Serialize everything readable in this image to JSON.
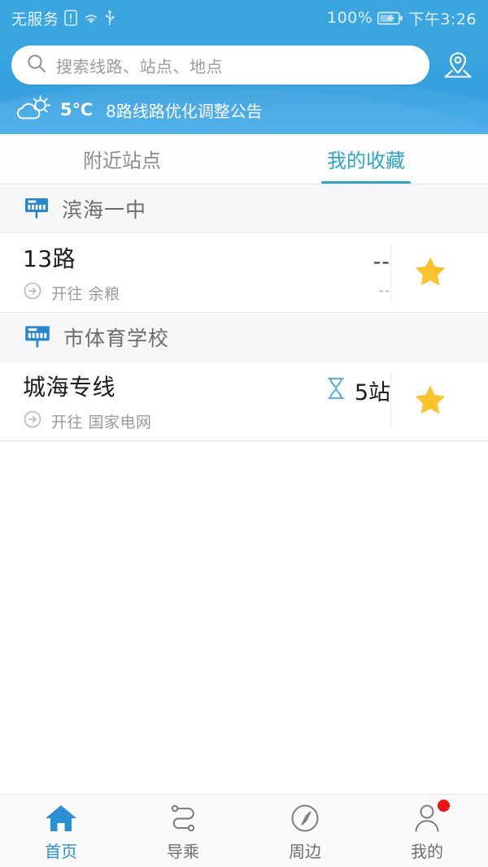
{
  "statusbar": {
    "carrier": "无服务",
    "battery_percent": "100%",
    "time": "下午3:26",
    "icons": [
      "sim-warning-icon",
      "wifi-icon",
      "usb-icon",
      "battery-charging-icon"
    ]
  },
  "header": {
    "search": {
      "placeholder": "搜索线路、站点、地点",
      "icon": "search-icon"
    },
    "map_button_icon": "map-location-pin-icon",
    "weather": {
      "icon": "sun-behind-cloud-icon",
      "temperature": "5℃"
    },
    "notice": "8路线路优化调整公告"
  },
  "tabs": [
    {
      "label": "附近站点",
      "active": false
    },
    {
      "label": "我的收藏",
      "active": true
    }
  ],
  "stations": [
    {
      "name": "滨海一中",
      "icon": "bus-stop-sign-icon",
      "routes": [
        {
          "name": "13路",
          "direction_icon": "arrow-right-circle-icon",
          "direction": "开往 余粮",
          "status_icon": null,
          "status_main": "--",
          "status_sub": "--",
          "favorite_icon": "star-filled-icon",
          "favorited": true
        }
      ]
    },
    {
      "name": "市体育学校",
      "icon": "bus-stop-sign-icon",
      "routes": [
        {
          "name": "城海专线",
          "direction_icon": "arrow-right-circle-icon",
          "direction": "开往 国家电网",
          "status_icon": "hourglass-icon",
          "status_main": "5站",
          "status_sub": "",
          "favorite_icon": "star-filled-icon",
          "favorited": true
        }
      ]
    }
  ],
  "bottom_nav": [
    {
      "label": "首页",
      "icon": "home-icon",
      "active": true,
      "badge": false
    },
    {
      "label": "导乘",
      "icon": "route-path-icon",
      "active": false,
      "badge": false
    },
    {
      "label": "周边",
      "icon": "compass-icon",
      "active": false,
      "badge": false
    },
    {
      "label": "我的",
      "icon": "user-person-icon",
      "active": false,
      "badge": true
    }
  ],
  "colors": {
    "header_blue": "#3ba5e0",
    "tab_active": "#31a3c6",
    "star_yellow": "#f9c22e",
    "nav_active": "#2b8fd4",
    "badge_red": "#ef1212",
    "stop_icon_blue": "#2a86c8"
  }
}
